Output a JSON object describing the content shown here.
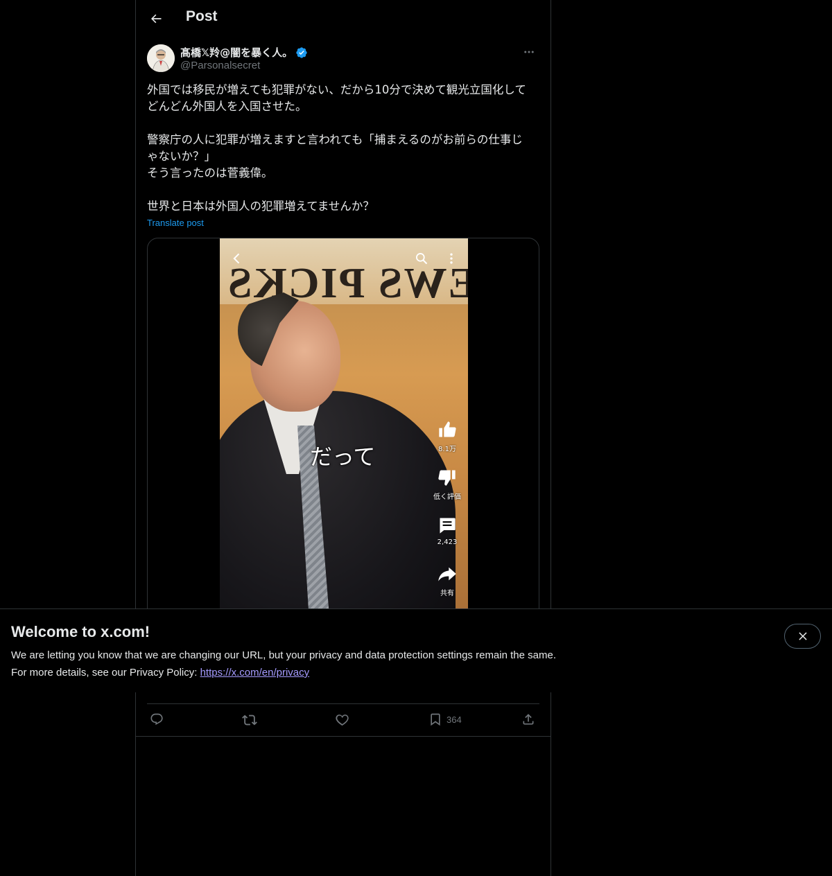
{
  "header": {
    "title": "Post"
  },
  "post": {
    "author_name": "髙橋𝕏羚@闇を暴く人。",
    "author_handle": "@Parsonalsecret",
    "verified": true,
    "text_lines": [
      "外国では移民が増えても犯罪がない、だから10分で決めて観光立国化して",
      "どんどん外国人を入国させた。",
      "",
      "警察庁の人に犯罪が増えますと言われても「捕まえるのがお前らの仕事じ",
      "ゃないか？」",
      "そう言ったのは菅義偉。",
      "",
      "世界と日本は外国人の犯罪増えてませんか？"
    ],
    "translate_label": "Translate post"
  },
  "video": {
    "subtitle": "だって",
    "like_count": "8.1万",
    "dislike_label": "低く評価",
    "comment_count": "2,423",
    "share_label": "共有",
    "sign_text": "NEWS PICKS"
  },
  "actions": {
    "bookmark_count": "364"
  },
  "banner": {
    "title": "Welcome to x.com!",
    "line1": "We are letting you know that we are changing our URL, but your privacy and data protection settings remain the same.",
    "line2_prefix": "For more details, see our Privacy Policy: ",
    "link_text": "https://x.com/en/privacy"
  },
  "colors": {
    "background": "#000000",
    "text": "#e7e9ea",
    "muted": "#71767b",
    "accent": "#1d9bf0",
    "border": "#2f3336",
    "link": "#a59bff"
  },
  "icons": {
    "back": "arrow-left-icon",
    "verified": "verified-badge-icon",
    "more": "more-horizontal-icon",
    "reply": "reply-icon",
    "repost": "repost-icon",
    "like": "heart-icon",
    "bookmark": "bookmark-icon",
    "share": "share-icon",
    "close": "close-icon"
  }
}
